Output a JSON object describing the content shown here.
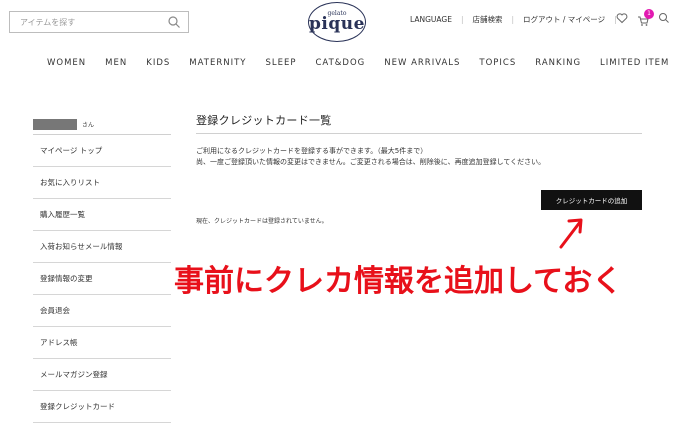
{
  "header": {
    "search_placeholder": "アイテムを探す",
    "logo_small": "gelato",
    "logo_big": "pique",
    "links": [
      "LANGUAGE",
      "店舗検索",
      "ログアウト / マイページ"
    ],
    "cart_count": "1"
  },
  "nav": [
    "WOMEN",
    "MEN",
    "KIDS",
    "MATERNITY",
    "SLEEP",
    "CAT&DOG",
    "NEW ARRIVALS",
    "TOPICS",
    "RANKING",
    "LIMITED ITEM"
  ],
  "sidebar": {
    "user_suffix": "さん",
    "items": [
      "マイページ トップ",
      "お気に入りリスト",
      "購入履歴一覧",
      "入荷お知らせメール情報",
      "登録情報の変更",
      "会員退会",
      "アドレス帳",
      "メールマガジン登録",
      "登録クレジットカード"
    ]
  },
  "main": {
    "title": "登録クレジットカード一覧",
    "desc_line1": "ご利用になるクレジットカードを登録する事ができます。（最大5件まで）",
    "desc_line2": "尚、一度ご登録頂いた情報の変更はできません。ご変更される場合は、削除後に、再度追加登録してください。",
    "add_button": "クレジットカードの追加",
    "empty_message": "現在、クレジットカードは登録されていません。"
  },
  "annotation": {
    "text": "事前にクレカ情報を追加しておく",
    "color": "#e8101a"
  },
  "colors": {
    "badge": "#e21ab1",
    "logo": "#2a3358"
  }
}
